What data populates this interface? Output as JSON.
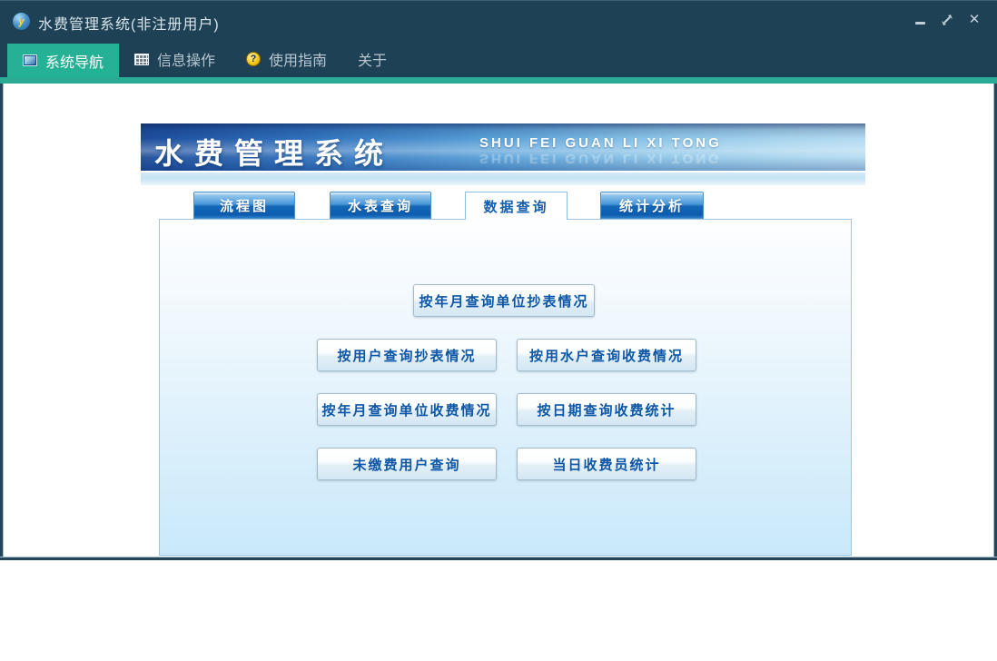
{
  "window": {
    "title": "水费管理系统(非注册用户)",
    "logo_glyph": "y",
    "controls": {
      "minimize": "minimize",
      "restore": "restore",
      "close_glyph": "✕"
    }
  },
  "menubar": {
    "items": [
      {
        "label": "系统导航",
        "icon": "window-icon",
        "active": true
      },
      {
        "label": "信息操作",
        "icon": "grid-icon",
        "active": false
      },
      {
        "label": "使用指南",
        "icon": "help-icon",
        "active": false
      },
      {
        "label": "关于",
        "icon": null,
        "active": false
      }
    ],
    "help_glyph": "?"
  },
  "banner": {
    "title": "水费管理系统",
    "subtitle": "SHUI FEI GUAN LI XI TONG"
  },
  "tabs": [
    {
      "label": "流程图",
      "active": false
    },
    {
      "label": "水表查询",
      "active": false
    },
    {
      "label": "数据查询",
      "active": true
    },
    {
      "label": "统计分析",
      "active": false
    }
  ],
  "query_buttons": {
    "center": "按年月查询单位抄表情况",
    "row2_left": "按用户查询抄表情况",
    "row2_right": "按用水户查询收费情况",
    "row3_left": "按年月查询单位收费情况",
    "row3_right": "按日期查询收费统计",
    "row4_left": "未缴费用户查询",
    "row4_right": "当日收费员统计"
  },
  "colors": {
    "titlebar_bg": "#1e4155",
    "accent_green": "#2aab96",
    "menu_active_bg": "#25b195",
    "banner_blue_dark": "#1d4d9b",
    "banner_blue_light": "#b3daf1",
    "tab_blue": "#1568b6",
    "button_text_blue": "#0d57a6",
    "panel_fill_bottom": "#c9e9fb",
    "window_border": "#24455a"
  }
}
